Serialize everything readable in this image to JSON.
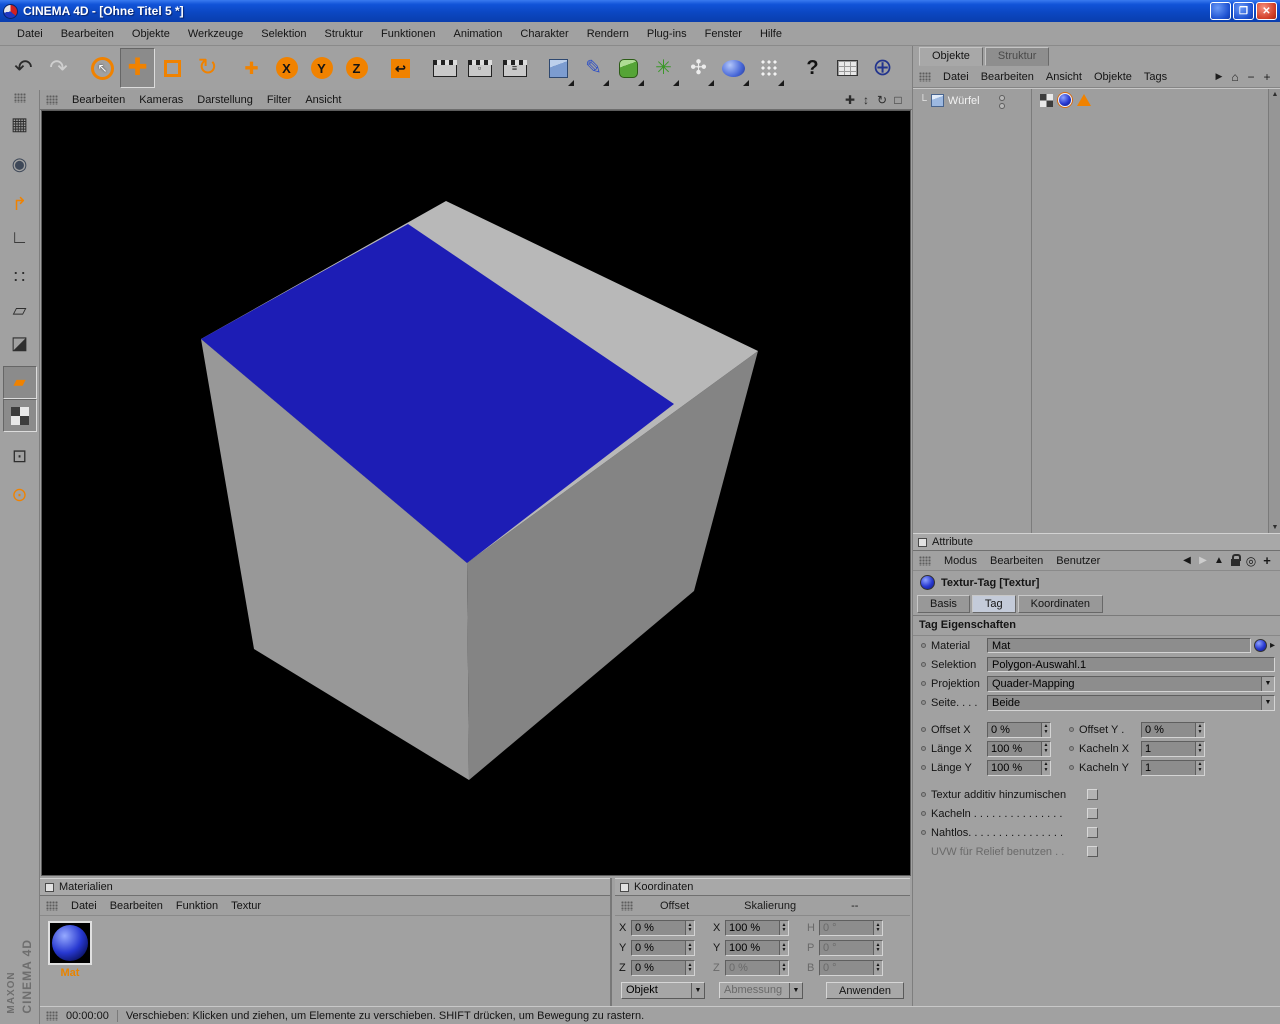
{
  "window": {
    "title": "CINEMA 4D - [Ohne Titel 5 *]"
  },
  "menubar": [
    "Datei",
    "Bearbeiten",
    "Objekte",
    "Werkzeuge",
    "Selektion",
    "Struktur",
    "Funktionen",
    "Animation",
    "Charakter",
    "Rendern",
    "Plug-ins",
    "Fenster",
    "Hilfe"
  ],
  "toolbar": {
    "icons": [
      {
        "name": "undo-icon",
        "glyph": "↶",
        "color": "#2b2b2b",
        "size": 22
      },
      {
        "name": "redo-icon",
        "glyph": "↷",
        "color": "#cfcfcf",
        "size": 22
      },
      {
        "name": "live-selection-tool",
        "cls": "ring",
        "glyph": "↖",
        "color": "#ffffff",
        "size": 12,
        "gap": true
      },
      {
        "name": "move-tool",
        "glyph": "✚",
        "color": "#f08200",
        "size": 24,
        "pressed": true
      },
      {
        "name": "scale-tool",
        "cls": "sqo"
      },
      {
        "name": "rotate-tool",
        "glyph": "↻",
        "color": "#f08200",
        "size": 24
      },
      {
        "name": "object-axis-tool",
        "glyph": "✚",
        "color": "#f08200",
        "size": 17,
        "gap": true
      },
      {
        "name": "lock-x-axis-toggle",
        "cls": "c-or",
        "glyph": "X"
      },
      {
        "name": "lock-y-axis-toggle",
        "cls": "c-or",
        "glyph": "Y"
      },
      {
        "name": "lock-z-axis-toggle",
        "cls": "c-or",
        "glyph": "Z"
      },
      {
        "name": "coordinate-system-toggle",
        "cls": "sqf",
        "glyph": "↩",
        "gap": true
      },
      {
        "name": "render-view-icon",
        "cls": "clap",
        "gap": true
      },
      {
        "name": "render-picture-viewer-icon",
        "cls": "clap",
        "glyph": "▫"
      },
      {
        "name": "render-settings-icon",
        "cls": "clap",
        "glyph": "≡"
      },
      {
        "name": "add-cube-primitive-icon",
        "cls": "cube-b",
        "dd": true,
        "gap": true
      },
      {
        "name": "add-spline-icon",
        "glyph": "✎",
        "color": "#3454c4",
        "size": 20,
        "dd": true
      },
      {
        "name": "add-nurbs-icon",
        "cls": "cube-g",
        "dd": true
      },
      {
        "name": "add-modeling-object-icon",
        "glyph": "✳",
        "color": "#3a9828",
        "size": 20,
        "dd": true
      },
      {
        "name": "add-scene-object-icon",
        "glyph": "✣",
        "color": "#ededed",
        "size": 20,
        "dd": true
      },
      {
        "name": "add-deformer-icon",
        "cls": "blob",
        "dd": true
      },
      {
        "name": "add-particle-system-icon",
        "cls": "dotsw",
        "dd": true
      },
      {
        "name": "help-icon",
        "glyph": "?",
        "color": "#111111",
        "size": 20,
        "bold": true,
        "gap": true
      },
      {
        "name": "command-manager-icon",
        "cls": "mtab"
      },
      {
        "name": "browser-icon",
        "glyph": "⊕",
        "color": "#22348e",
        "size": 24
      }
    ]
  },
  "leftbar": {
    "icons": [
      {
        "name": "convert-object-icon",
        "glyph": "▦",
        "color": "#2e2e2e",
        "size": 18
      },
      {
        "name": "model-mode-icon",
        "glyph": "◉",
        "color": "#3e4858",
        "size": 18,
        "gap": true
      },
      {
        "name": "object-axis-mode-icon",
        "glyph": "↱",
        "color": "#f08200",
        "size": 18,
        "gap": true
      },
      {
        "name": "texture-axis-mode-icon",
        "glyph": "∟",
        "color": "#2e2e2e",
        "size": 18
      },
      {
        "name": "points-mode-icon",
        "glyph": "∷",
        "color": "#2e2e2e",
        "size": 18,
        "gap": true
      },
      {
        "name": "edges-mode-icon",
        "glyph": "▱",
        "color": "#2e2e2e",
        "size": 18
      },
      {
        "name": "polygons-mode-icon",
        "glyph": "◪",
        "color": "#2e2e2e",
        "size": 18
      },
      {
        "name": "texture-mode-icon",
        "glyph": "▰",
        "color": "#f08200",
        "size": 16,
        "pressed": true,
        "gap": true
      },
      {
        "name": "uv-mode-icon",
        "cls": "checker",
        "pressed": true
      },
      {
        "name": "uvw-edit-mode-icon",
        "glyph": "⊡",
        "color": "#2e2e2e",
        "size": 18,
        "gap": true
      },
      {
        "name": "kinematics-mode-icon",
        "glyph": "⊙",
        "color": "#f08200",
        "size": 19,
        "gap": true
      }
    ]
  },
  "viewport": {
    "menu": [
      "Bearbeiten",
      "Kameras",
      "Darstellung",
      "Filter",
      "Ansicht"
    ],
    "corner_icons": [
      {
        "name": "viewport-pan-icon",
        "glyph": "✚",
        "color": "#2c2c2c",
        "size": 12
      },
      {
        "name": "viewport-zoom-icon",
        "glyph": "↕",
        "color": "#2c2c2c",
        "size": 12
      },
      {
        "name": "viewport-rotate-icon",
        "glyph": "↻",
        "color": "#2c2c2c",
        "size": 12
      },
      {
        "name": "viewport-toggle-icon",
        "glyph": "□",
        "color": "#2c2c2c",
        "size": 12
      }
    ]
  },
  "scene": {
    "cube_top_color": "#b8b8b8",
    "cube_blue_color": "#1d1db5",
    "cube_left_color": "#989898",
    "cube_right_color": "#848484",
    "background_color": "#000000"
  },
  "object_manager": {
    "tabs": [
      "Objekte",
      "Struktur"
    ],
    "active_tab": "Objekte",
    "menu": [
      "Datei",
      "Bearbeiten",
      "Ansicht",
      "Objekte",
      "Tags"
    ],
    "toolbar_icons": [
      {
        "name": "om-expand-icon",
        "glyph": "▶",
        "color": "#1e1e1e",
        "size": 9
      },
      {
        "name": "om-home-icon",
        "glyph": "⌂",
        "color": "#1e1e1e",
        "size": 12
      },
      {
        "name": "om-collapse-icon",
        "glyph": "−",
        "color": "#1e1e1e",
        "size": 12
      },
      {
        "name": "om-add-icon",
        "glyph": "+",
        "color": "#1e1e1e",
        "size": 12
      }
    ],
    "objects": [
      {
        "name": "Würfel",
        "tags": [
          "polygon-selection-tag",
          "texture-tag",
          "phong-tag"
        ]
      }
    ]
  },
  "attributes": {
    "header": "Attribute",
    "menu": [
      "Modus",
      "Bearbeiten",
      "Benutzer"
    ],
    "toolbar_icons": [
      {
        "name": "attr-back-icon",
        "glyph": "◀",
        "color": "#181818",
        "size": 10
      },
      {
        "name": "attr-forward-icon",
        "glyph": "▶",
        "color": "#cdcdcd",
        "size": 10
      },
      {
        "name": "attr-up-icon",
        "glyph": "▲",
        "color": "#181818",
        "size": 10
      },
      {
        "name": "attr-lock-icon",
        "cls": "lock"
      },
      {
        "name": "attr-sync-icon",
        "glyph": "◎",
        "color": "#181818",
        "size": 12
      },
      {
        "name": "attr-add-icon",
        "glyph": "+",
        "color": "#181818",
        "size": 13,
        "bold": true
      }
    ],
    "object_label": "Textur-Tag [Textur]",
    "tabs": [
      "Basis",
      "Tag",
      "Koordinaten"
    ],
    "active_tab": "Tag",
    "section": "Tag Eigenschaften",
    "material": {
      "label": "Material",
      "value": "Mat"
    },
    "selektion": {
      "label": "Selektion",
      "value": "Polygon-Auswahl.1"
    },
    "projektion": {
      "label": "Projektion",
      "value": "Quader-Mapping"
    },
    "seite": {
      "label": "Seite. . . .",
      "value": "Beide"
    },
    "offset_x": {
      "label": "Offset X",
      "value": "0 %"
    },
    "offset_y": {
      "label": "Offset Y .",
      "value": "0 %"
    },
    "laenge_x": {
      "label": "Länge X",
      "value": "100 %"
    },
    "laenge_y": {
      "label": "Länge Y",
      "value": "100 %"
    },
    "kacheln_x": {
      "label": "Kacheln X",
      "value": "1"
    },
    "kacheln_y": {
      "label": "Kacheln Y",
      "value": "1"
    },
    "checkboxes": [
      {
        "label": "Textur additiv hinzumischen",
        "checked": false
      },
      {
        "label": "Kacheln . . . . . . . . . . . . . . .",
        "checked": false
      },
      {
        "label": "Nahtlos. . . . . . . . . . . . . . . .",
        "checked": false
      },
      {
        "label": "UVW für Relief benutzen . .",
        "checked": false,
        "disabled": true
      }
    ]
  },
  "materials": {
    "header": "Materialien",
    "menu": [
      "Datei",
      "Bearbeiten",
      "Funktion",
      "Textur"
    ],
    "items": [
      {
        "name": "Mat",
        "selected": true
      }
    ]
  },
  "coordinates": {
    "header": "Koordinaten",
    "columns": [
      "Offset",
      "Skalierung",
      "--"
    ],
    "rows": [
      {
        "a_label": "X",
        "a": "0 %",
        "b_label": "X",
        "b": "100 %",
        "c_label": "H",
        "c": "0 °"
      },
      {
        "a_label": "Y",
        "a": "0 %",
        "b_label": "Y",
        "b": "100 %",
        "c_label": "P",
        "c": "0 °"
      },
      {
        "a_label": "Z",
        "a": "0 %",
        "b_label": "Z",
        "b": "0 %",
        "c_label": "B",
        "c": "0 °"
      }
    ],
    "mode_left": "Objekt",
    "mode_right": "Abmessung",
    "apply_label": "Anwenden"
  },
  "statusbar": {
    "time": "00:00:00",
    "message": "Verschieben: Klicken und ziehen, um Elemente zu verschieben. SHIFT drücken, um Bewegung zu rastern."
  },
  "branding": {
    "maxon": "MAXON",
    "product": "CINEMA 4D"
  }
}
